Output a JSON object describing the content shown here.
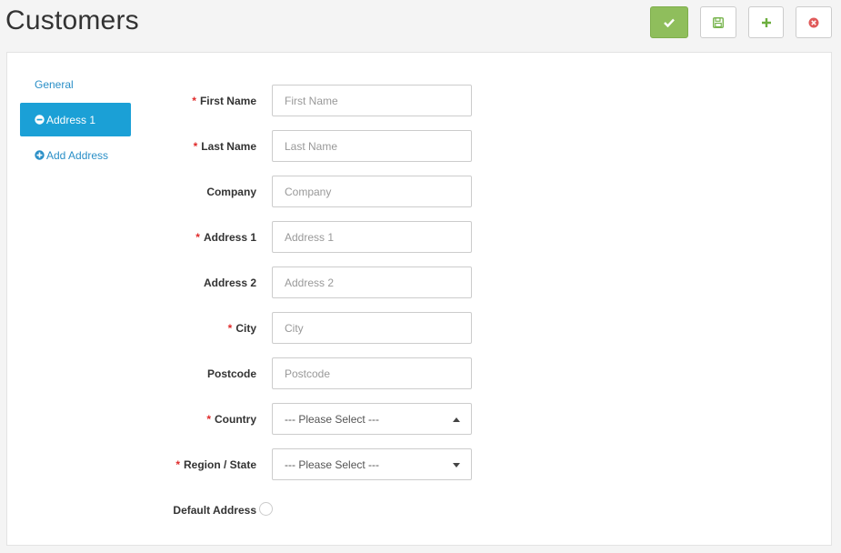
{
  "header": {
    "title": "Customers"
  },
  "toolbar": {
    "buttons": [
      {
        "name": "save-close-button",
        "icon": "check-icon",
        "color": "#8fbe5c"
      },
      {
        "name": "save-button",
        "icon": "floppy-disk-icon"
      },
      {
        "name": "add-button",
        "icon": "plus-icon",
        "color": "#6cae3e"
      },
      {
        "name": "close-button",
        "icon": "close-circle-icon",
        "color": "#e05a5a"
      }
    ]
  },
  "sidebar": {
    "items": [
      {
        "label": "General",
        "icon": ""
      },
      {
        "label": "Address 1",
        "icon": "minus-circle-icon"
      },
      {
        "label": "Add Address",
        "icon": "plus-circle-icon"
      }
    ],
    "active_color": "#1ba0d6",
    "link_color": "#2a8fc7"
  },
  "form": {
    "fields": [
      {
        "label": "First Name",
        "required": true,
        "type": "text",
        "placeholder": "First Name",
        "value": ""
      },
      {
        "label": "Last Name",
        "required": true,
        "type": "text",
        "placeholder": "Last Name",
        "value": ""
      },
      {
        "label": "Company",
        "required": false,
        "type": "text",
        "placeholder": "Company",
        "value": ""
      },
      {
        "label": "Address 1",
        "required": true,
        "type": "text",
        "placeholder": "Address 1",
        "value": ""
      },
      {
        "label": "Address 2",
        "required": false,
        "type": "text",
        "placeholder": "Address 2",
        "value": ""
      },
      {
        "label": "City",
        "required": true,
        "type": "text",
        "placeholder": "City",
        "value": ""
      },
      {
        "label": "Postcode",
        "required": false,
        "type": "text",
        "placeholder": "Postcode",
        "value": ""
      },
      {
        "label": "Country",
        "required": true,
        "type": "select",
        "selected": "--- Please Select ---"
      },
      {
        "label": "Region / State",
        "required": true,
        "type": "select",
        "selected": "--- Please Select ---"
      },
      {
        "label": "Default Address",
        "required": false,
        "type": "radio",
        "checked": false
      }
    ],
    "required_marker": "*",
    "required_color": "#e02b2b"
  }
}
